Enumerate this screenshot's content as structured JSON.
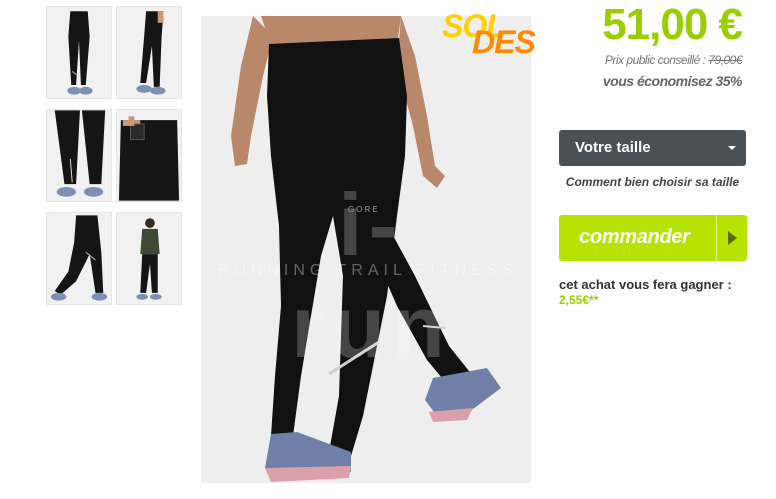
{
  "sale_badge": {
    "part1": "SOL",
    "part2": "DES",
    "color_1": "#ffd000",
    "color_2": "#ff8a00"
  },
  "price": {
    "current": "51,00 €",
    "color": "#9acd05"
  },
  "msrp": {
    "label": "Prix public conseillé :",
    "value": "79,00€"
  },
  "savings": {
    "text": "vous économisez 35%"
  },
  "size_select": {
    "label": "Votre taille",
    "background": "#495156"
  },
  "size_guide": {
    "text": "Comment bien choisir sa taille"
  },
  "order_button": {
    "label": "commander",
    "color": "#b7e300"
  },
  "reward": {
    "label": "cet achat vous fera gagner :",
    "value": "2,55€**"
  },
  "main_image": {
    "watermark_letters": "i-run",
    "watermark_text": "RUNNING TRAIL FITNESS",
    "product_logo": "GORE"
  },
  "thumbnails": [
    {
      "name": "thumb-front-full"
    },
    {
      "name": "thumb-side-full"
    },
    {
      "name": "thumb-back-zip"
    },
    {
      "name": "thumb-pocket"
    },
    {
      "name": "thumb-lunge"
    },
    {
      "name": "thumb-full-outfit"
    }
  ]
}
